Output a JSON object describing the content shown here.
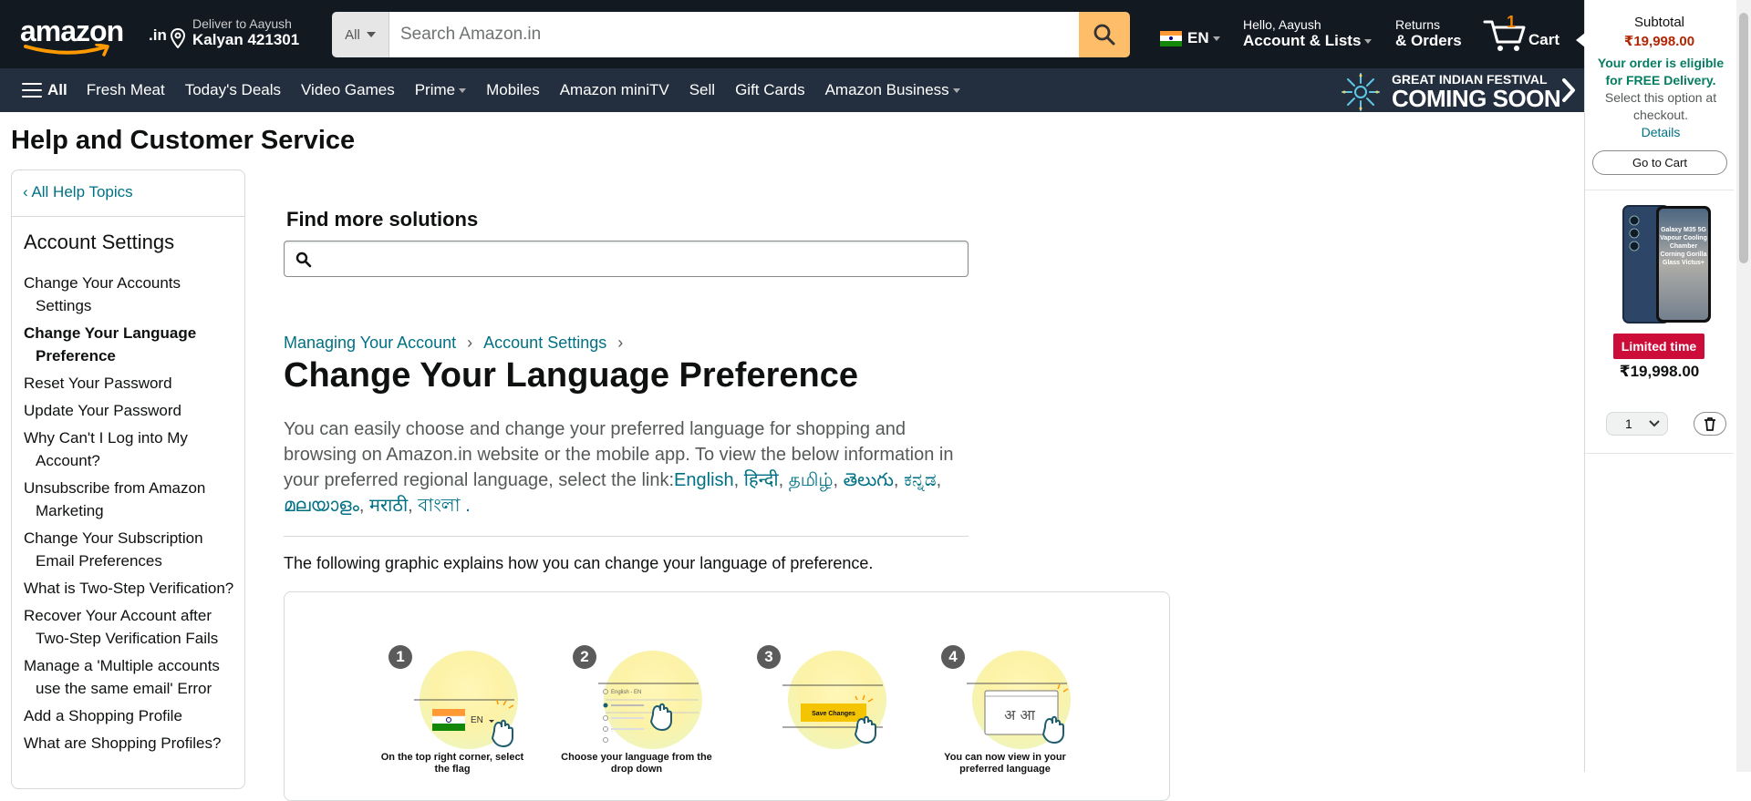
{
  "header": {
    "logo_word": "amazon",
    "logo_tld": ".in",
    "deliver_line1": "Deliver to Aayush",
    "deliver_line2": "Kalyan 421301",
    "search_category": "All",
    "search_placeholder": "Search Amazon.in",
    "language_code": "EN",
    "account_line1": "Hello, Aayush",
    "account_line2": "Account & Lists",
    "returns_line1": "Returns",
    "returns_line2": "& Orders",
    "cart_count": "1",
    "cart_label": "Cart"
  },
  "nav": {
    "all_label": "All",
    "items": [
      "Fresh Meat",
      "Today's Deals",
      "Video Games",
      "Prime",
      "Mobiles",
      "Amazon miniTV",
      "Sell",
      "Gift Cards",
      "Amazon Business"
    ],
    "promo_line1": "GREAT INDIAN FESTIVAL",
    "promo_line2": "COMING SOON"
  },
  "page": {
    "title": "Help and Customer Service"
  },
  "sidebar": {
    "back_label": "‹ All Help Topics",
    "heading": "Account Settings",
    "items": [
      {
        "label": "Change Your Accounts Settings",
        "active": false
      },
      {
        "label": "Change Your Language Preference",
        "active": true
      },
      {
        "label": "Reset Your Password",
        "active": false
      },
      {
        "label": "Update Your Password",
        "active": false
      },
      {
        "label": "Why Can't I Log into My Account?",
        "active": false
      },
      {
        "label": "Unsubscribe from Amazon Marketing",
        "active": false
      },
      {
        "label": "Change Your Subscription Email Preferences",
        "active": false
      },
      {
        "label": "What is Two-Step Verification?",
        "active": false
      },
      {
        "label": "Recover Your Account after Two-Step Verification Fails",
        "active": false
      },
      {
        "label": "Manage a 'Multiple accounts use the same email' Error",
        "active": false
      },
      {
        "label": "Add a Shopping Profile",
        "active": false
      },
      {
        "label": "What are Shopping Profiles?",
        "active": false
      }
    ]
  },
  "find": {
    "title": "Find more solutions",
    "value": "",
    "placeholder": ""
  },
  "article": {
    "breadcrumb": [
      "Managing Your Account",
      "Account Settings"
    ],
    "breadcrumb_sep": "›",
    "title": "Change Your Language Preference",
    "intro_text": "You can easily choose and change your preferred language for shopping and browsing on Amazon.in website or the mobile app. To view the below information in your preferred regional language, select the link:",
    "language_links": [
      "English",
      "हिन्दी",
      "தமிழ்",
      "తెలుగు",
      "ಕನ್ನಡ",
      "മലയാളം",
      "मराठी",
      "বাংলা"
    ],
    "intro_end": " .",
    "graphic_note": "The following graphic explains how you can change your language of preference.",
    "steps": [
      {
        "number": "1",
        "caption": "On the top right corner, select the flag",
        "scene_text": "EN"
      },
      {
        "number": "2",
        "caption": "Choose your language from the drop down",
        "scene_text": "English - EN"
      },
      {
        "number": "3",
        "caption": "",
        "scene_text": "Save Changes"
      },
      {
        "number": "4",
        "caption": "You can now view in your preferred language",
        "scene_text": "अ आ"
      }
    ]
  },
  "cart_panel": {
    "subtotal_label": "Subtotal",
    "subtotal_value": "₹19,998.00",
    "free_bold": "Your order is eligible for FREE Delivery.",
    "free_rest": " Select this option at checkout.",
    "details_link": "Details",
    "goto_cart": "Go to Cart",
    "product_screen_text": "Galaxy M35 5G Vapour Cooling Chamber Corning Gorilla Glass Victus+",
    "badge": "Limited time",
    "price": "₹19,998.00",
    "quantity": "1"
  },
  "colors": {
    "nav_belt": "#131921",
    "nav_main": "#232f3e",
    "link": "#007185",
    "search_button": "#febd69",
    "price_red": "#b12704",
    "deal_badge": "#cc0c39",
    "free_green": "#067d62"
  },
  "icons": {
    "logo_smile": "amazon-smile-icon",
    "location": "location-pin-icon",
    "search": "search-icon",
    "flag": "india-flag-icon",
    "cart": "cart-icon",
    "menu": "hamburger-icon",
    "delete": "trash-icon"
  }
}
